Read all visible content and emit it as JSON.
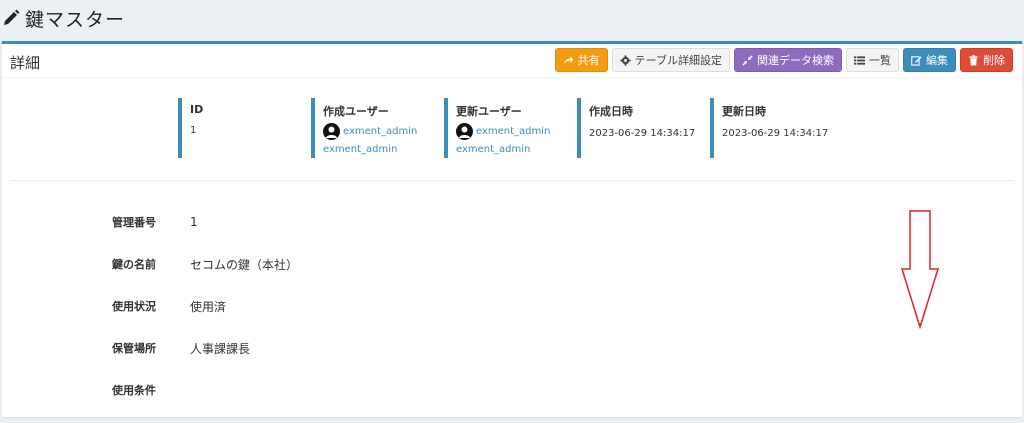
{
  "header": {
    "title": "鍵マスター",
    "icon": "pencil-icon"
  },
  "box": {
    "title": "詳細"
  },
  "toolbar": {
    "share": "共有",
    "table_settings": "テーブル詳細設定",
    "related_search": "関連データ検索",
    "list": "一覧",
    "edit": "編集",
    "delete": "削除"
  },
  "info": {
    "id": {
      "label": "ID",
      "value": "1"
    },
    "created_user": {
      "label": "作成ユーザー",
      "name": "exment_admin",
      "name2": "exment_admin"
    },
    "updated_user": {
      "label": "更新ユーザー",
      "name": "exment_admin",
      "name2": "exment_admin"
    },
    "created_at": {
      "label": "作成日時",
      "value": "2023-06-29 14:34:17"
    },
    "updated_at": {
      "label": "更新日時",
      "value": "2023-06-29 14:34:17"
    }
  },
  "fields": [
    {
      "label": "管理番号",
      "value": "1"
    },
    {
      "label": "鍵の名前",
      "value": "セコムの鍵（本社）"
    },
    {
      "label": "使用状況",
      "value": "使用済"
    },
    {
      "label": "保管場所",
      "value": "人事課課長"
    },
    {
      "label": "使用条件",
      "value": ""
    }
  ],
  "colors": {
    "accent": "#3c8dbc",
    "share": "#f39c12",
    "related": "#8e6bbf",
    "delete": "#dd4b39",
    "annotation_arrow": "#e02020"
  }
}
